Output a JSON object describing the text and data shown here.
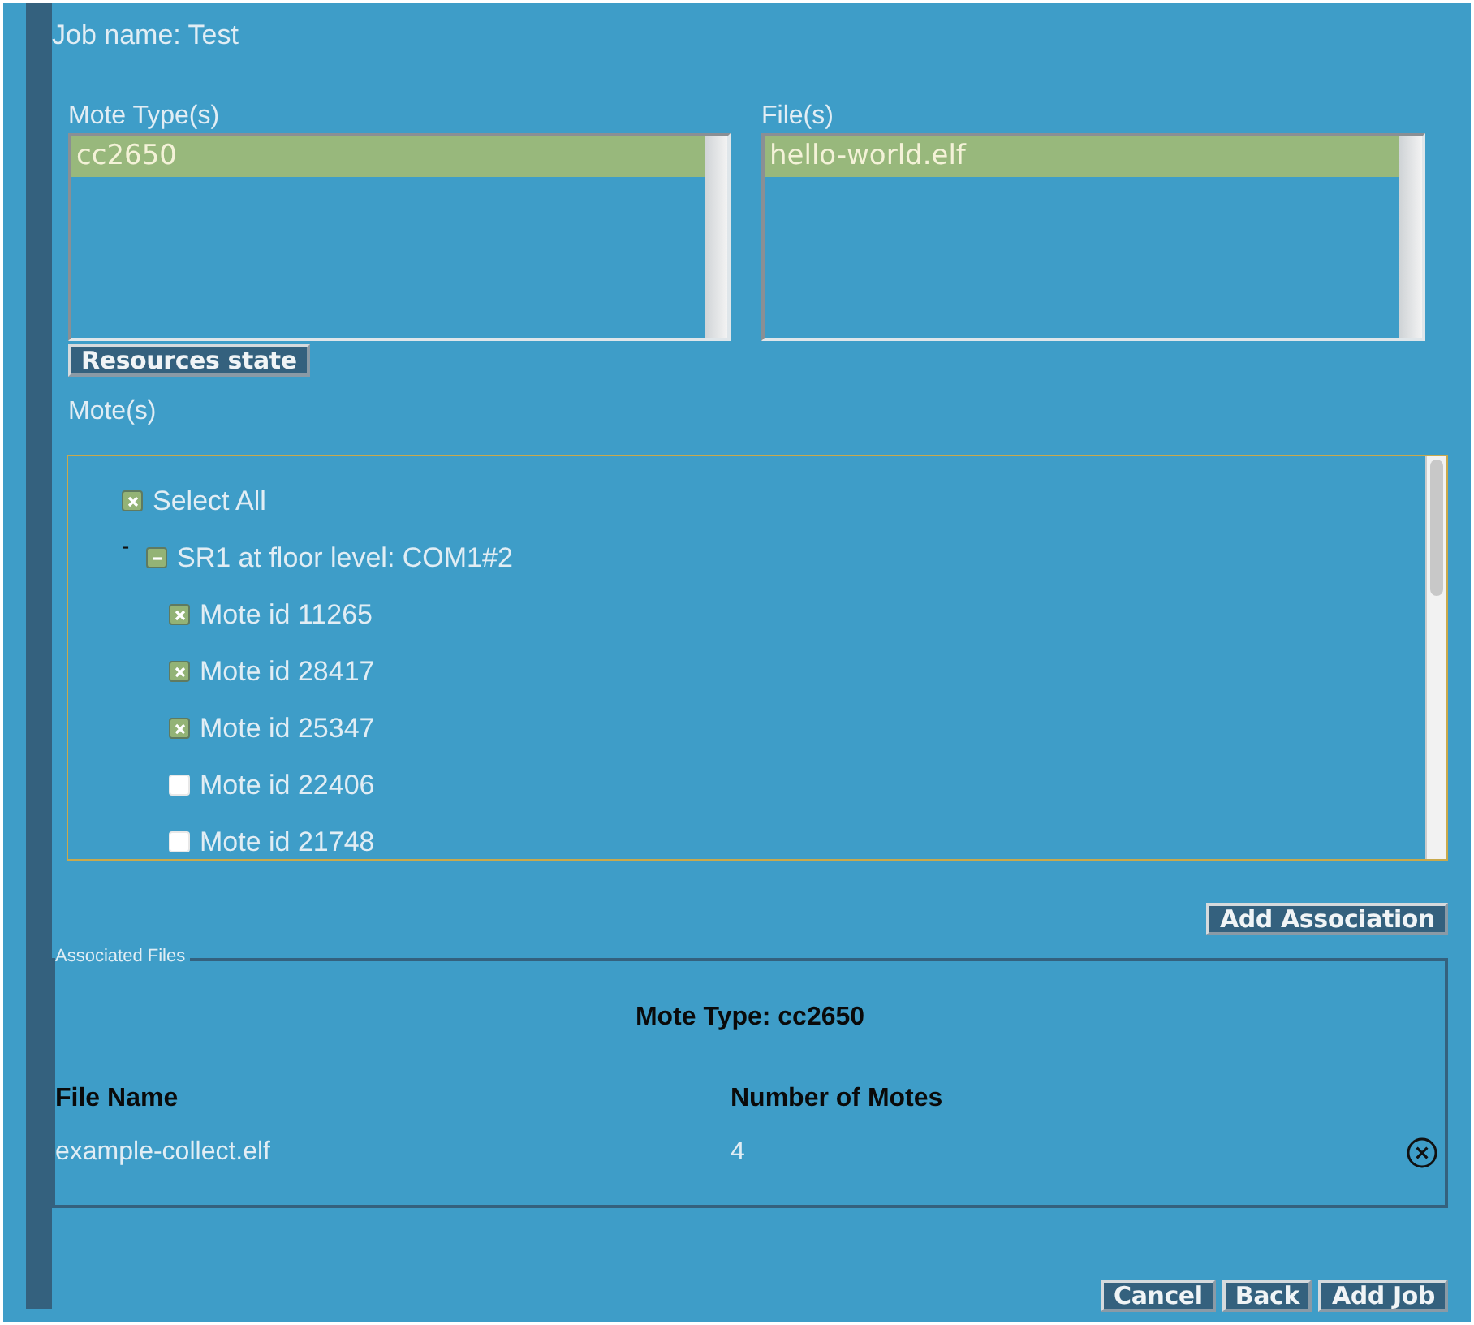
{
  "job_name": "Job name: Test",
  "mote_types": {
    "label": "Mote Type(s)",
    "items": [
      {
        "label": "cc2650",
        "selected": true
      }
    ]
  },
  "files": {
    "label": "File(s)",
    "items": [
      {
        "label": "hello-world.elf",
        "selected": true
      }
    ]
  },
  "resources_button": "Resources state",
  "motes": {
    "label": "Mote(s)",
    "tree": [
      {
        "label": "Select All",
        "checked": true
      },
      {
        "label": "SR1 at floor level: COM1#2",
        "toggle": "-",
        "expanded": true,
        "partial": true,
        "children": [
          {
            "label": "Mote id 11265",
            "checked": true
          },
          {
            "label": "Mote id 28417",
            "checked": true
          },
          {
            "label": "Mote id 25347",
            "checked": true
          },
          {
            "label": "Mote id 22406",
            "checked": false
          },
          {
            "label": "Mote id 21748",
            "checked": false
          }
        ]
      }
    ]
  },
  "add_association_button": "Add Association",
  "associated_files": {
    "legend": "Associated Files",
    "heading": "Mote Type: cc2650",
    "columns": [
      "File Name",
      "Number of Motes"
    ],
    "rows": [
      {
        "file": "example-collect.elf",
        "count": "4"
      }
    ]
  },
  "buttons": [
    "Cancel",
    "Back",
    "Add Job"
  ]
}
